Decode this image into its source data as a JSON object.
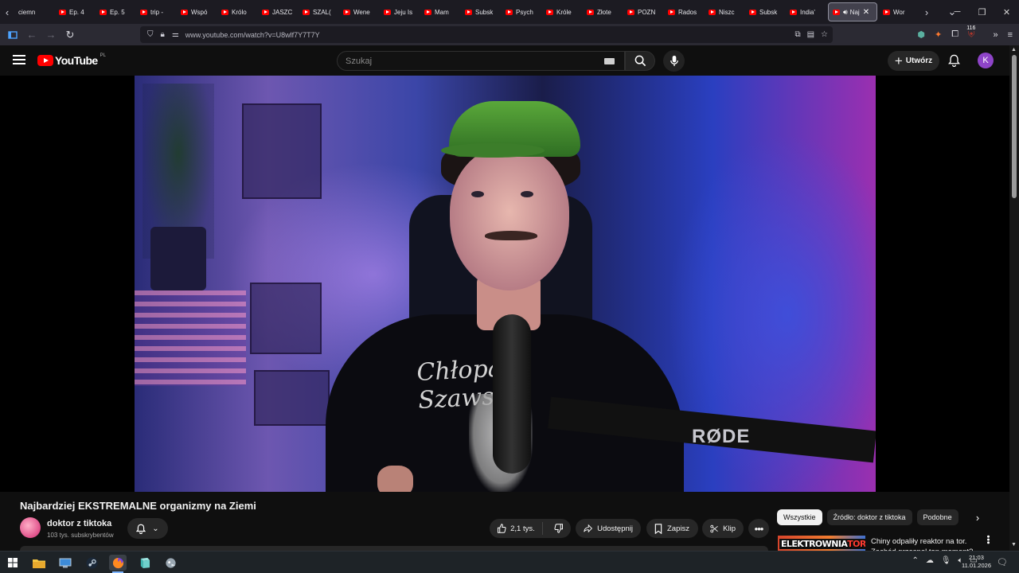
{
  "browser": {
    "tabs": [
      {
        "label": "ciemn",
        "has_favicon": false
      },
      {
        "label": "Ep. 4",
        "has_favicon": true
      },
      {
        "label": "Ep. 5",
        "has_favicon": true
      },
      {
        "label": "trip -",
        "has_favicon": true
      },
      {
        "label": "Wspó",
        "has_favicon": true
      },
      {
        "label": "Królo",
        "has_favicon": true
      },
      {
        "label": "JASZC",
        "has_favicon": true
      },
      {
        "label": "SZAL(",
        "has_favicon": true
      },
      {
        "label": "Wene",
        "has_favicon": true
      },
      {
        "label": "Jeju Is",
        "has_favicon": true
      },
      {
        "label": "Mam",
        "has_favicon": true
      },
      {
        "label": "Subsk",
        "has_favicon": true
      },
      {
        "label": "Psych",
        "has_favicon": true
      },
      {
        "label": "Króle",
        "has_favicon": true
      },
      {
        "label": "Złote",
        "has_favicon": true
      },
      {
        "label": "POZN",
        "has_favicon": true
      },
      {
        "label": "Rados",
        "has_favicon": true
      },
      {
        "label": "Niszc",
        "has_favicon": true
      },
      {
        "label": "Subsk",
        "has_favicon": true
      },
      {
        "label": "India'",
        "has_favicon": true
      }
    ],
    "active_tab": {
      "label": "Naj",
      "audio": true
    },
    "tabs_after": [
      {
        "label": "Wor",
        "has_favicon": true
      }
    ],
    "url": "www.youtube.com/watch?v=U8wlf7Y7T7Y",
    "extension_badge": "116"
  },
  "youtube": {
    "logo_text": "YouTube",
    "country_code": "PL",
    "search_placeholder": "Szukaj",
    "create_label": "Utwórz",
    "avatar_letter": "K",
    "brand_color": "#ff0000",
    "avatar_color": "#8e44c8"
  },
  "video": {
    "overlay_text": "RØDE",
    "shirt_text": "Chłopaki Szawski",
    "title": "Najbardziej EKSTREMALNE organizmy na Ziemi",
    "channel_name": "doktor z tiktoka",
    "subscribers": "103 tys. subskrybentów",
    "likes": "2,1 tys.",
    "share_label": "Udostępnij",
    "save_label": "Zapisz",
    "clip_label": "Klip"
  },
  "sidebar": {
    "chips": [
      "Wszystkie",
      "Źródło: doktor z tiktoka",
      "Podobne"
    ],
    "selected_chip": "Wszystkie",
    "recommendation": {
      "thumb_text_1": "ELEKTROWNIA",
      "thumb_text_2": "TOROWA?",
      "title": "Chiny odpaliły reaktor na tor. Zachód przespał ten moment?"
    }
  },
  "taskbar": {
    "time": "21:03",
    "date": "11.01.2026"
  }
}
